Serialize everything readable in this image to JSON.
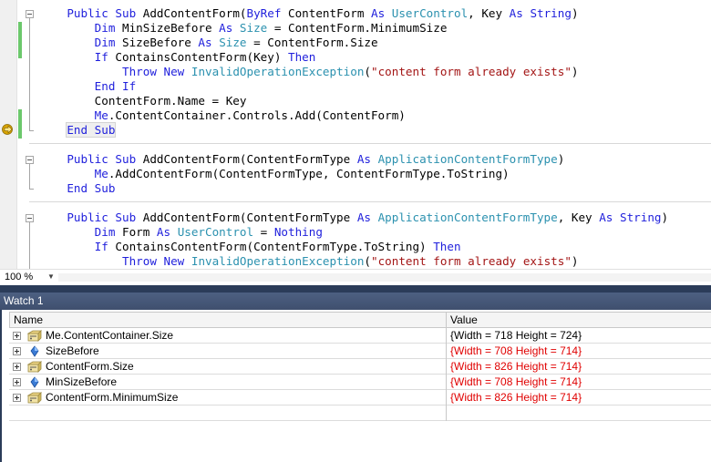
{
  "editor": {
    "lines": [
      [
        {
          "t": "    "
        },
        {
          "t": "Public Sub",
          "c": "kw"
        },
        {
          "t": " AddContentForm("
        },
        {
          "t": "ByRef",
          "c": "kw"
        },
        {
          "t": " ContentForm "
        },
        {
          "t": "As",
          "c": "kw"
        },
        {
          "t": " "
        },
        {
          "t": "UserControl",
          "c": "ty"
        },
        {
          "t": ", Key "
        },
        {
          "t": "As",
          "c": "kw"
        },
        {
          "t": " "
        },
        {
          "t": "String",
          "c": "kw"
        },
        {
          "t": ")"
        }
      ],
      [
        {
          "t": "        "
        },
        {
          "t": "Dim",
          "c": "kw"
        },
        {
          "t": " MinSizeBefore "
        },
        {
          "t": "As",
          "c": "kw"
        },
        {
          "t": " "
        },
        {
          "t": "Size",
          "c": "ty"
        },
        {
          "t": " = ContentForm.MinimumSize"
        }
      ],
      [
        {
          "t": "        "
        },
        {
          "t": "Dim",
          "c": "kw"
        },
        {
          "t": " SizeBefore "
        },
        {
          "t": "As",
          "c": "kw"
        },
        {
          "t": " "
        },
        {
          "t": "Size",
          "c": "ty"
        },
        {
          "t": " = ContentForm.Size"
        }
      ],
      [
        {
          "t": "        "
        },
        {
          "t": "If",
          "c": "kw"
        },
        {
          "t": " ContainsContentForm(Key) "
        },
        {
          "t": "Then",
          "c": "kw"
        }
      ],
      [
        {
          "t": "            "
        },
        {
          "t": "Throw",
          "c": "kw"
        },
        {
          "t": " "
        },
        {
          "t": "New",
          "c": "kw"
        },
        {
          "t": " "
        },
        {
          "t": "InvalidOperationException",
          "c": "ty"
        },
        {
          "t": "("
        },
        {
          "t": "\"content form already exists\"",
          "c": "st"
        },
        {
          "t": ")"
        }
      ],
      [
        {
          "t": "        "
        },
        {
          "t": "End If",
          "c": "kw"
        }
      ],
      [
        {
          "t": "        ContentForm.Name = Key"
        }
      ],
      [
        {
          "t": "        "
        },
        {
          "t": "Me",
          "c": "kw"
        },
        {
          "t": ".ContentContainer.Controls.Add(ContentForm)"
        }
      ],
      [
        {
          "t": "    "
        },
        {
          "t": "End Sub",
          "c": "kw",
          "hl": true
        }
      ],
      [
        {
          "t": ""
        }
      ],
      [
        {
          "t": "    "
        },
        {
          "t": "Public Sub",
          "c": "kw"
        },
        {
          "t": " AddContentForm(ContentFormType "
        },
        {
          "t": "As",
          "c": "kw"
        },
        {
          "t": " "
        },
        {
          "t": "ApplicationContentFormType",
          "c": "ty"
        },
        {
          "t": ")"
        }
      ],
      [
        {
          "t": "        "
        },
        {
          "t": "Me",
          "c": "kw"
        },
        {
          "t": ".AddContentForm(ContentFormType, ContentFormType.ToString)"
        }
      ],
      [
        {
          "t": "    "
        },
        {
          "t": "End Sub",
          "c": "kw"
        }
      ],
      [
        {
          "t": ""
        }
      ],
      [
        {
          "t": "    "
        },
        {
          "t": "Public Sub",
          "c": "kw"
        },
        {
          "t": " AddContentForm(ContentFormType "
        },
        {
          "t": "As",
          "c": "kw"
        },
        {
          "t": " "
        },
        {
          "t": "ApplicationContentFormType",
          "c": "ty"
        },
        {
          "t": ", Key "
        },
        {
          "t": "As",
          "c": "kw"
        },
        {
          "t": " "
        },
        {
          "t": "String",
          "c": "kw"
        },
        {
          "t": ")"
        }
      ],
      [
        {
          "t": "        "
        },
        {
          "t": "Dim",
          "c": "kw"
        },
        {
          "t": " Form "
        },
        {
          "t": "As",
          "c": "kw"
        },
        {
          "t": " "
        },
        {
          "t": "UserControl",
          "c": "ty"
        },
        {
          "t": " = "
        },
        {
          "t": "Nothing",
          "c": "kw"
        }
      ],
      [
        {
          "t": "        "
        },
        {
          "t": "If",
          "c": "kw"
        },
        {
          "t": " ContainsContentForm(ContentFormType.ToString) "
        },
        {
          "t": "Then",
          "c": "kw"
        }
      ],
      [
        {
          "t": "            "
        },
        {
          "t": "Throw",
          "c": "kw"
        },
        {
          "t": " "
        },
        {
          "t": "New",
          "c": "kw"
        },
        {
          "t": " "
        },
        {
          "t": "InvalidOperationException",
          "c": "ty"
        },
        {
          "t": "("
        },
        {
          "t": "\"content form already exists\"",
          "c": "st"
        },
        {
          "t": ")"
        }
      ]
    ]
  },
  "zoom": {
    "value": "100 %"
  },
  "watch": {
    "title": "Watch 1",
    "columns": {
      "name": "Name",
      "value": "Value"
    },
    "rows": [
      {
        "name": "Me.ContentContainer.Size",
        "value": "{Width = 718 Height = 724}",
        "icon": "property-icon",
        "value_color": "#000000"
      },
      {
        "name": "SizeBefore",
        "value": "{Width = 708 Height = 714}",
        "icon": "variable-icon",
        "value_color": "#e00000"
      },
      {
        "name": "ContentForm.Size",
        "value": "{Width = 826 Height = 714}",
        "icon": "property-icon",
        "value_color": "#e00000"
      },
      {
        "name": "MinSizeBefore",
        "value": "{Width = 708 Height = 714}",
        "icon": "variable-icon",
        "value_color": "#e00000"
      },
      {
        "name": "ContentForm.MinimumSize",
        "value": "{Width = 826 Height = 714}",
        "icon": "property-icon",
        "value_color": "#e00000"
      }
    ]
  }
}
